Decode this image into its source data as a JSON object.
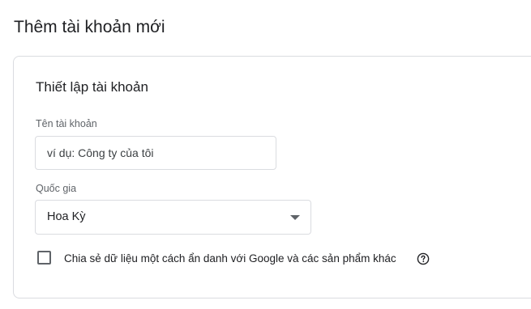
{
  "page": {
    "title": "Thêm tài khoản mới"
  },
  "account_setup": {
    "section_title": "Thiết lập tài khoản",
    "account_name": {
      "label": "Tên tài khoản",
      "placeholder": "ví dụ: Công ty của tôi",
      "value": ""
    },
    "country": {
      "label": "Quốc gia",
      "selected": "Hoa Kỳ",
      "icon": "dropdown-arrow-icon"
    },
    "share_data": {
      "label": "Chia sẻ dữ liệu một cách ẩn danh với Google và các sản phẩm khác",
      "checked": false,
      "help_icon": "help-circle-icon"
    }
  },
  "colors": {
    "text_primary": "#202124",
    "text_secondary": "#5f6368",
    "border": "#dadce0"
  }
}
